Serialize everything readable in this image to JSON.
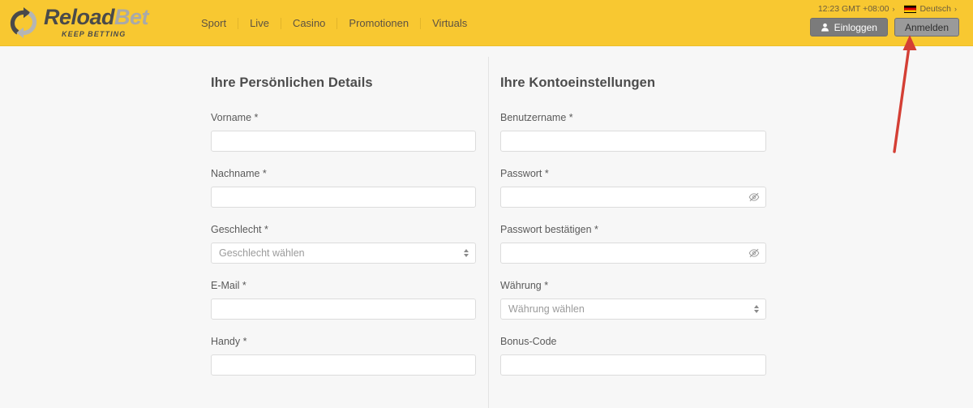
{
  "header": {
    "logo": {
      "icon": "reload-circular-arrows-icon",
      "name_part1": "Reload",
      "name_part2": "Bet",
      "tagline": "KEEP BETTING"
    },
    "nav_items": [
      {
        "label": "Sport"
      },
      {
        "label": "Live"
      },
      {
        "label": "Casino"
      },
      {
        "label": "Promotionen"
      },
      {
        "label": "Virtuals"
      }
    ],
    "clock": {
      "time": "12:23",
      "zone": "GMT +08:00",
      "full": "12:23 GMT +08:00",
      "chevron": "›"
    },
    "language": {
      "flag": "german-flag-icon",
      "label": "Deutsch",
      "chevron": "›"
    },
    "login_button": {
      "label": "Einloggen",
      "icon": "user-icon"
    },
    "register_button": {
      "label": "Anmelden"
    },
    "colors": {
      "background": "#f8c831",
      "login_bg": "#7b7b7b",
      "register_bg": "#9a9a9a"
    }
  },
  "form": {
    "left_column": {
      "title": "Ihre Persönlichen Details",
      "fields": [
        {
          "label": "Vorname *",
          "type": "text",
          "value": "",
          "placeholder": ""
        },
        {
          "label": "Nachname *",
          "type": "text",
          "value": "",
          "placeholder": ""
        },
        {
          "label": "Geschlecht *",
          "type": "select",
          "value": "",
          "placeholder": "Geschlecht wählen"
        },
        {
          "label": "E-Mail *",
          "type": "text",
          "value": "",
          "placeholder": ""
        },
        {
          "label": "Handy *",
          "type": "text",
          "value": "",
          "placeholder": ""
        }
      ]
    },
    "right_column": {
      "title": "Ihre Kontoeinstellungen",
      "fields": [
        {
          "label": "Benutzername *",
          "type": "text",
          "value": "",
          "placeholder": ""
        },
        {
          "label": "Passwort *",
          "type": "password",
          "value": "",
          "placeholder": ""
        },
        {
          "label": "Passwort bestätigen *",
          "type": "password",
          "value": "",
          "placeholder": ""
        },
        {
          "label": "Währung *",
          "type": "select",
          "value": "",
          "placeholder": "Währung wählen"
        },
        {
          "label": "Bonus-Code",
          "type": "text",
          "value": "",
          "placeholder": ""
        }
      ]
    }
  },
  "annotation": {
    "type": "arrow",
    "color": "#d43f35",
    "points_to": "register-button"
  }
}
